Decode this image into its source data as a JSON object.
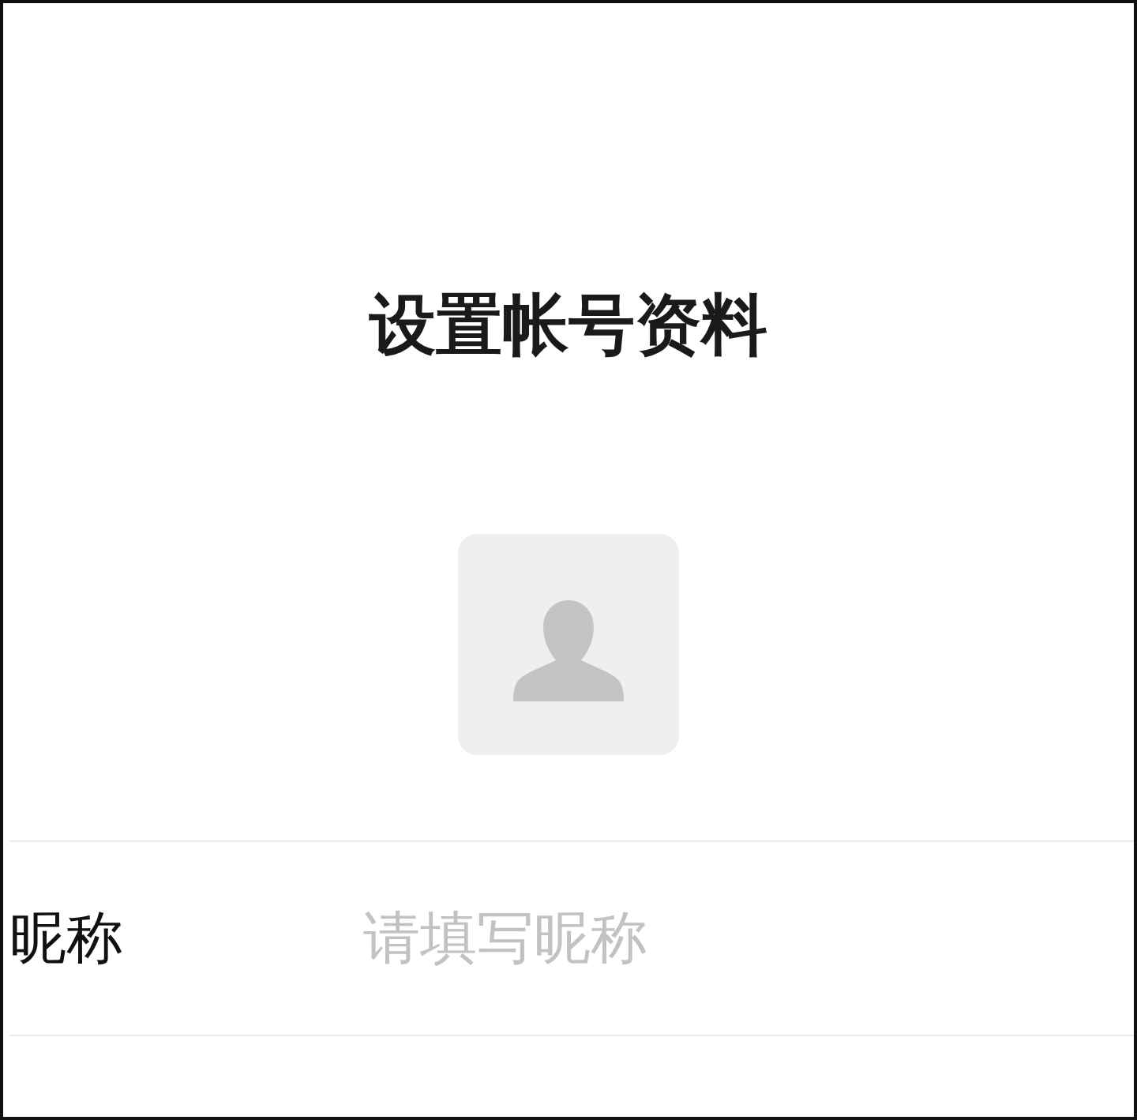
{
  "title": "设置帐号资料",
  "avatar": {
    "kind": "placeholder"
  },
  "form": {
    "rows": [
      {
        "label": "昵称",
        "placeholder": "请填写昵称"
      }
    ]
  }
}
